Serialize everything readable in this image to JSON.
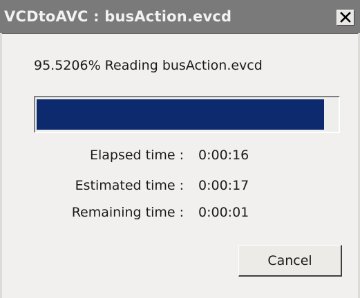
{
  "window": {
    "title": "VCDtoAVC : busAction.evcd"
  },
  "progress": {
    "status_text": "95.5206% Reading busAction.evcd",
    "fraction": 0.955206,
    "fill_color": "#0d2a6e"
  },
  "times": [
    {
      "label": "Elapsed time :",
      "value": "0:00:16"
    },
    {
      "label": "Estimated time :",
      "value": "0:00:17"
    },
    {
      "label": "Remaining time :",
      "value": "0:00:01"
    }
  ],
  "buttons": {
    "cancel_label": "Cancel"
  },
  "icons": {
    "close": "close-icon"
  },
  "colors": {
    "titlebar": "#7a7a7a",
    "window_bg": "#f1f0ee",
    "progress": "#0d2a6e"
  }
}
